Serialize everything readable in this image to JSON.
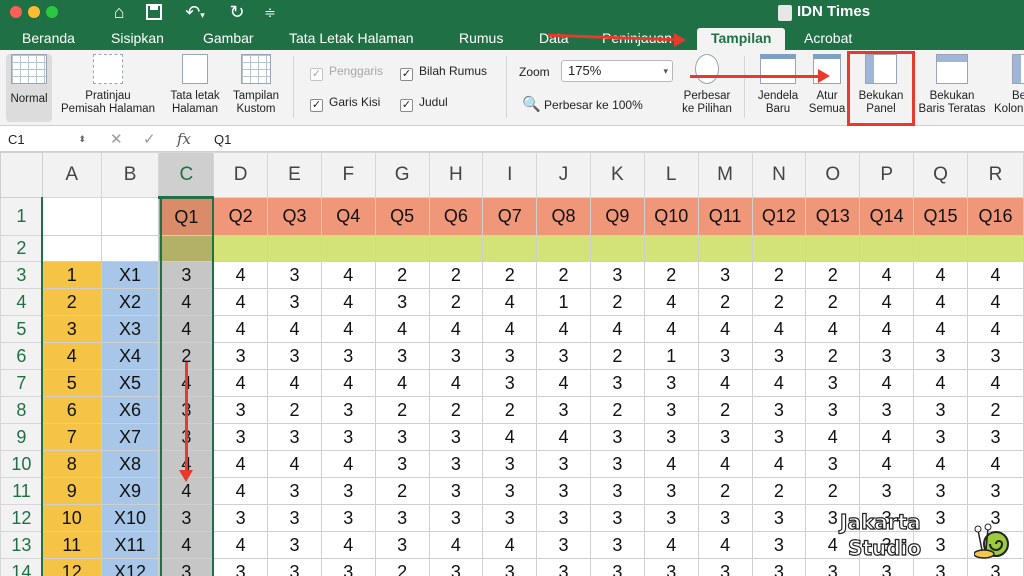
{
  "window": {
    "title": "IDN Times"
  },
  "tabs": [
    "Beranda",
    "Sisipkan",
    "Gambar",
    "Tata Letak Halaman",
    "Rumus",
    "Data",
    "Peninjauan",
    "Tampilan",
    "Acrobat"
  ],
  "active_tab": "Tampilan",
  "ribbon": {
    "normal": "Normal",
    "pagebreak": [
      "Pratinjau",
      "Pemisah Halaman"
    ],
    "layout": [
      "Tata letak",
      "Halaman"
    ],
    "custom": [
      "Tampilan",
      "Kustom"
    ],
    "checks": {
      "ruler": "Penggaris",
      "formulabar": "Bilah Rumus",
      "gridlines": "Garis Kisi",
      "headings": "Judul"
    },
    "zoom_label": "Zoom",
    "zoom_value": "175%",
    "zoom100": "Perbesar ke 100%",
    "zoom_selection": [
      "Perbesar",
      "ke Pilihan"
    ],
    "new_window": [
      "Jendela",
      "Baru"
    ],
    "arrange_all": [
      "Atur",
      "Semua"
    ],
    "freeze_panes": [
      "Bekukan",
      "Panel"
    ],
    "freeze_top_row": [
      "Bekukan",
      "Baris Teratas"
    ],
    "freeze_first_col": [
      "Be",
      "Kolon"
    ]
  },
  "formula": {
    "cell_ref": "C1",
    "fx": "fx",
    "value": "Q1"
  },
  "sheet": {
    "columns": [
      "A",
      "B",
      "C",
      "D",
      "E",
      "F",
      "G",
      "H",
      "I",
      "J",
      "K",
      "L",
      "M",
      "N",
      "O",
      "P",
      "Q",
      "R"
    ],
    "header_row": [
      "",
      "",
      "Q1",
      "Q2",
      "Q3",
      "Q4",
      "Q5",
      "Q6",
      "Q7",
      "Q8",
      "Q9",
      "Q10",
      "Q11",
      "Q12",
      "Q13",
      "Q14",
      "Q15",
      "Q16"
    ],
    "rows": [
      {
        "n": "3",
        "a": "1",
        "b": "X1",
        "v": [
          "3",
          "4",
          "3",
          "4",
          "2",
          "2",
          "2",
          "2",
          "3",
          "2",
          "3",
          "2",
          "2",
          "4",
          "4",
          "4"
        ]
      },
      {
        "n": "4",
        "a": "2",
        "b": "X2",
        "v": [
          "4",
          "4",
          "3",
          "4",
          "3",
          "2",
          "4",
          "1",
          "2",
          "4",
          "2",
          "2",
          "2",
          "4",
          "4",
          "4"
        ]
      },
      {
        "n": "5",
        "a": "3",
        "b": "X3",
        "v": [
          "4",
          "4",
          "4",
          "4",
          "4",
          "4",
          "4",
          "4",
          "4",
          "4",
          "4",
          "4",
          "4",
          "4",
          "4",
          "4"
        ]
      },
      {
        "n": "6",
        "a": "4",
        "b": "X4",
        "v": [
          "2",
          "3",
          "3",
          "3",
          "3",
          "3",
          "3",
          "3",
          "2",
          "1",
          "3",
          "3",
          "2",
          "3",
          "3",
          "3"
        ]
      },
      {
        "n": "7",
        "a": "5",
        "b": "X5",
        "v": [
          "4",
          "4",
          "4",
          "4",
          "4",
          "4",
          "3",
          "4",
          "3",
          "3",
          "4",
          "4",
          "3",
          "4",
          "4",
          "4"
        ]
      },
      {
        "n": "8",
        "a": "6",
        "b": "X6",
        "v": [
          "3",
          "3",
          "2",
          "3",
          "2",
          "2",
          "2",
          "3",
          "2",
          "3",
          "2",
          "3",
          "3",
          "3",
          "3",
          "2"
        ]
      },
      {
        "n": "9",
        "a": "7",
        "b": "X7",
        "v": [
          "3",
          "3",
          "3",
          "3",
          "3",
          "3",
          "4",
          "4",
          "3",
          "3",
          "3",
          "3",
          "4",
          "4",
          "3",
          "3"
        ]
      },
      {
        "n": "10",
        "a": "8",
        "b": "X8",
        "v": [
          "4",
          "4",
          "4",
          "4",
          "3",
          "3",
          "3",
          "3",
          "3",
          "4",
          "4",
          "4",
          "3",
          "4",
          "4",
          "4"
        ]
      },
      {
        "n": "11",
        "a": "9",
        "b": "X9",
        "v": [
          "4",
          "4",
          "3",
          "3",
          "2",
          "3",
          "3",
          "3",
          "3",
          "3",
          "2",
          "2",
          "2",
          "3",
          "3",
          "3"
        ]
      },
      {
        "n": "12",
        "a": "10",
        "b": "X10",
        "v": [
          "3",
          "3",
          "3",
          "3",
          "3",
          "3",
          "3",
          "3",
          "3",
          "3",
          "3",
          "3",
          "3",
          "3",
          "3",
          "3"
        ]
      },
      {
        "n": "13",
        "a": "11",
        "b": "X11",
        "v": [
          "4",
          "4",
          "3",
          "4",
          "3",
          "4",
          "4",
          "3",
          "3",
          "4",
          "4",
          "3",
          "4",
          "3",
          "3",
          "3"
        ]
      },
      {
        "n": "14",
        "a": "12",
        "b": "X12",
        "v": [
          "3",
          "3",
          "3",
          "3",
          "2",
          "3",
          "3",
          "3",
          "3",
          "3",
          "3",
          "3",
          "3",
          "3",
          "3",
          "3"
        ]
      }
    ]
  },
  "watermark": {
    "line1": "Jakarta",
    "line2": "Studio"
  },
  "colors": {
    "excel_green": "#1f7145",
    "annotation_red": "#e8392d",
    "col_a": "#f5c446",
    "col_b": "#a7c6e8",
    "header_row": "#f0977a",
    "row2": "#d4e377"
  }
}
